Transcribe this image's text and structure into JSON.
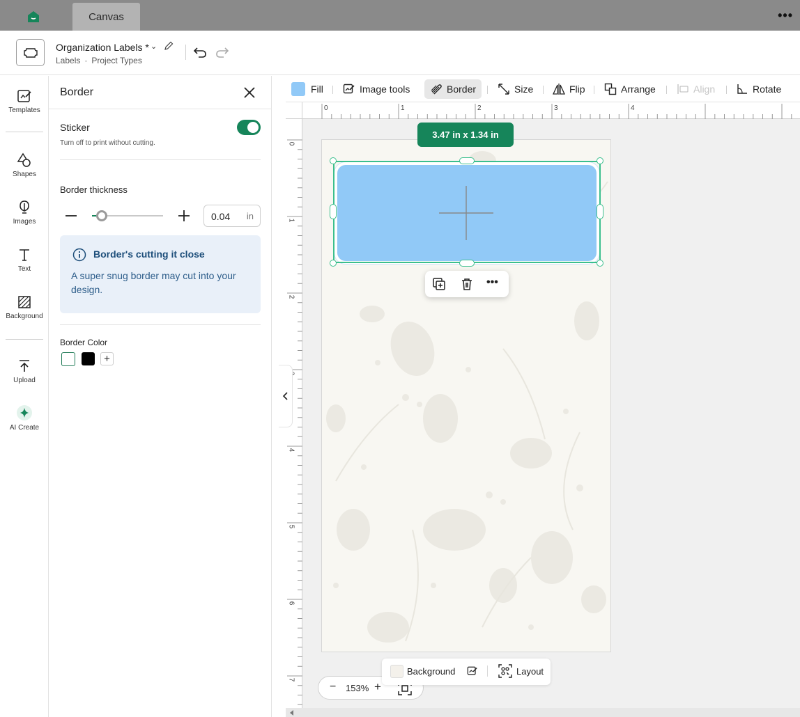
{
  "colors": {
    "accent": "#16855a",
    "selection": "#3bbf8d",
    "shape_fill": "#91c9f7",
    "notice_bg": "#e9f0f9"
  },
  "tabs": {
    "active": "Canvas"
  },
  "header": {
    "project_title": "Organization Labels *",
    "sub_category": "Labels",
    "sub_type": "Project Types"
  },
  "rail": {
    "items": [
      {
        "label": "Templates",
        "icon": "templates-icon"
      },
      {
        "label": "Shapes",
        "icon": "shapes-icon"
      },
      {
        "label": "Images",
        "icon": "images-icon"
      },
      {
        "label": "Text",
        "icon": "text-icon"
      },
      {
        "label": "Background",
        "icon": "background-icon"
      },
      {
        "label": "Upload",
        "icon": "upload-icon"
      },
      {
        "label": "AI Create",
        "icon": "sparkle-icon"
      }
    ]
  },
  "panel": {
    "title": "Border",
    "sticker_label": "Sticker",
    "sticker_help": "Turn off to print without cutting.",
    "sticker_on": true,
    "thickness_label": "Border thickness",
    "thickness_value": "0.04",
    "thickness_unit": "in",
    "notice_title": "Border's cutting it close",
    "notice_body": "A super snug border may cut into your design.",
    "color_label": "Border Color"
  },
  "toolbar": {
    "fill": "Fill",
    "image_tools": "Image tools",
    "border": "Border",
    "size": "Size",
    "flip": "Flip",
    "arrange": "Arrange",
    "align": "Align",
    "rotate": "Rotate"
  },
  "ruler": {
    "h": [
      "0",
      "1",
      "2",
      "3",
      "4"
    ],
    "v": [
      "0",
      "1",
      "2",
      "3",
      "4",
      "5",
      "6",
      "7"
    ]
  },
  "canvas": {
    "dimensions": "3.47 in x 1.34 in",
    "background_label": "Background",
    "layout_label": "Layout",
    "zoom": "153%"
  }
}
